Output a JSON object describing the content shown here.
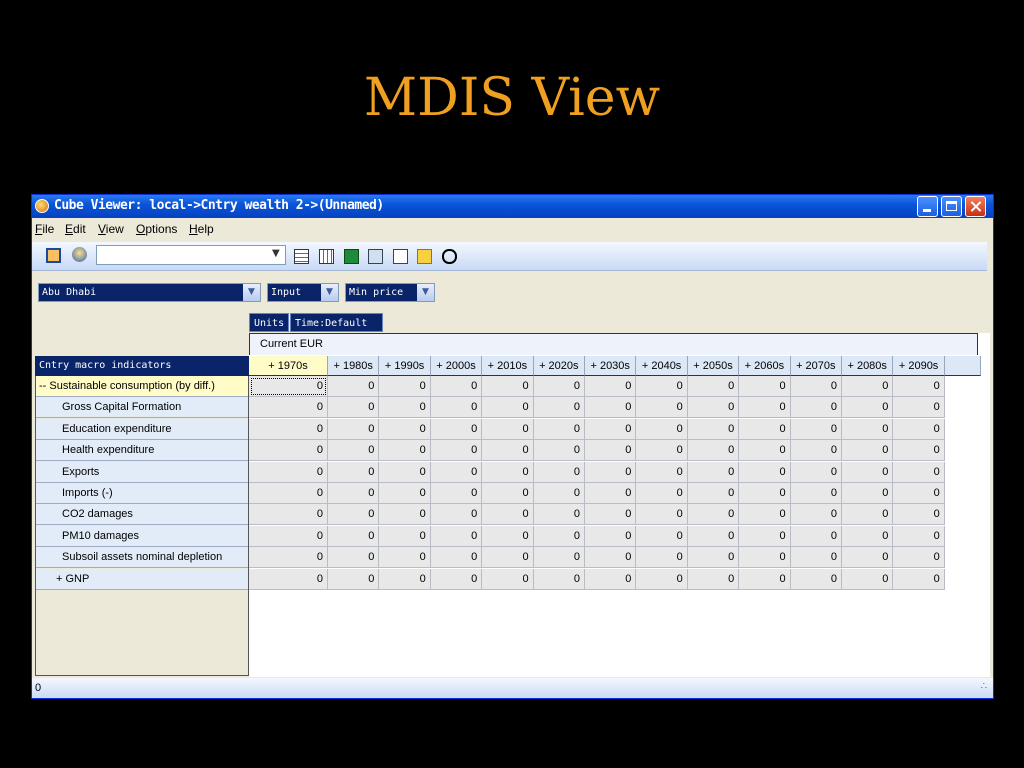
{
  "slide": {
    "title": "MDIS View"
  },
  "window": {
    "title": "Cube Viewer: local->Cntry wealth 2->(Unnamed)",
    "controls": {
      "minimize": "minimize-icon",
      "maximize": "maximize-icon",
      "close": "close-icon"
    }
  },
  "menu": [
    "File",
    "Edit",
    "View",
    "Options",
    "Help"
  ],
  "toolbar": {
    "combo_value": "",
    "icons": [
      "save-view-icon",
      "recalculate-icon",
      "calculator-icon",
      "sheet-icon",
      "excel-export-icon",
      "slice-icon",
      "edit-icon",
      "next-icon",
      "zero-suppress-icon"
    ]
  },
  "dimensions": {
    "region": "Abu Dhabi",
    "mode": "Input",
    "measure": "Min price",
    "units": "Units",
    "time": "Time:Default"
  },
  "grid": {
    "column_group": "Current EUR",
    "row_dimension": "Cntry macro indicators",
    "columns": [
      "+ 1970s",
      "+ 1980s",
      "+ 1990s",
      "+ 2000s",
      "+ 2010s",
      "+ 2020s",
      "+ 2030s",
      "+ 2040s",
      "+ 2050s",
      "+ 2060s",
      "+ 2070s",
      "+ 2080s",
      "+ 2090s"
    ],
    "rows": [
      {
        "label": "-- Sustainable consumption (by diff.)",
        "values": [
          "0",
          "0",
          "0",
          "0",
          "0",
          "0",
          "0",
          "0",
          "0",
          "0",
          "0",
          "0",
          "0"
        ]
      },
      {
        "label": "Gross Capital Formation",
        "values": [
          "0",
          "0",
          "0",
          "0",
          "0",
          "0",
          "0",
          "0",
          "0",
          "0",
          "0",
          "0",
          "0"
        ]
      },
      {
        "label": "Education expenditure",
        "values": [
          "0",
          "0",
          "0",
          "0",
          "0",
          "0",
          "0",
          "0",
          "0",
          "0",
          "0",
          "0",
          "0"
        ]
      },
      {
        "label": "Health expenditure",
        "values": [
          "0",
          "0",
          "0",
          "0",
          "0",
          "0",
          "0",
          "0",
          "0",
          "0",
          "0",
          "0",
          "0"
        ]
      },
      {
        "label": "Exports",
        "values": [
          "0",
          "0",
          "0",
          "0",
          "0",
          "0",
          "0",
          "0",
          "0",
          "0",
          "0",
          "0",
          "0"
        ]
      },
      {
        "label": "Imports (-)",
        "values": [
          "0",
          "0",
          "0",
          "0",
          "0",
          "0",
          "0",
          "0",
          "0",
          "0",
          "0",
          "0",
          "0"
        ]
      },
      {
        "label": "CO2 damages",
        "values": [
          "0",
          "0",
          "0",
          "0",
          "0",
          "0",
          "0",
          "0",
          "0",
          "0",
          "0",
          "0",
          "0"
        ]
      },
      {
        "label": "PM10 damages",
        "values": [
          "0",
          "0",
          "0",
          "0",
          "0",
          "0",
          "0",
          "0",
          "0",
          "0",
          "0",
          "0",
          "0"
        ]
      },
      {
        "label": "Subsoil assets nominal depletion",
        "values": [
          "0",
          "0",
          "0",
          "0",
          "0",
          "0",
          "0",
          "0",
          "0",
          "0",
          "0",
          "0",
          "0"
        ]
      },
      {
        "label": "+ GNP",
        "values": [
          "0",
          "0",
          "0",
          "0",
          "0",
          "0",
          "0",
          "0",
          "0",
          "0",
          "0",
          "0",
          "0"
        ]
      }
    ]
  },
  "status": {
    "text": "0"
  }
}
